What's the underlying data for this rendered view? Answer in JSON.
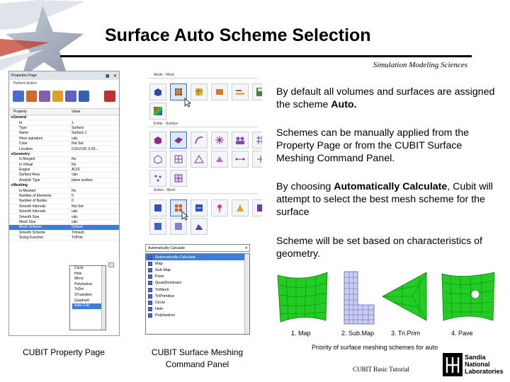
{
  "slide": {
    "title": "Surface Auto Scheme Selection",
    "subtitle": "Simulation Modeling Sciences",
    "footer": "CUBIT Basic Tutorial",
    "logo_lines": [
      "Sandia",
      "National",
      "Laboratories"
    ]
  },
  "property_page": {
    "header": "Properties Page",
    "perform_action_label": "Perform Action",
    "columns": [
      "Property",
      "Value"
    ],
    "rows": [
      {
        "group": true,
        "property": "General",
        "value": ""
      },
      {
        "property": "Id",
        "value": "1"
      },
      {
        "property": "Type",
        "value": "Surface"
      },
      {
        "property": "Name",
        "value": "Surface 1"
      },
      {
        "property": "Hess signature",
        "value": "calc"
      },
      {
        "property": "Color",
        "value": "Not Set"
      },
      {
        "property": "Location",
        "value": "0.00,0.00, 0.00..."
      },
      {
        "group": true,
        "property": "Geometry",
        "value": ""
      },
      {
        "property": "Is Merged",
        "value": "No"
      },
      {
        "property": "Is Virtual",
        "value": "No"
      },
      {
        "property": "Engine",
        "value": "ACIS"
      },
      {
        "property": "Surface Area",
        "value": "calc"
      },
      {
        "property": "Analytic Type",
        "value": "plane surface"
      },
      {
        "group": true,
        "property": "Meshing",
        "value": ""
      },
      {
        "property": "Is Meshed",
        "value": "No"
      },
      {
        "property": "Number of Elements",
        "value": "0"
      },
      {
        "property": "Number of Nodes",
        "value": "0"
      },
      {
        "property": "Smooth Intervals",
        "value": "Not Set"
      },
      {
        "property": "Smooth Intervals",
        "value": "calc"
      },
      {
        "property": "Smooth Size",
        "value": "calc"
      },
      {
        "property": "Mesh Size",
        "value": "calc"
      },
      {
        "property": "Mesh Scheme",
        "value": "Default",
        "selected": true
      },
      {
        "property": "Smooth Scheme",
        "value": "Trimesh"
      },
      {
        "property": "Sizing Function",
        "value": "TriPrim"
      }
    ],
    "dropdown_options": [
      "Circle",
      "Hole",
      "Mirror",
      "Polyhedron",
      "TriDel",
      "STransition",
      "Quadrant",
      "Auto Calc"
    ],
    "dropdown_selected": "Auto Calc",
    "dots_label": "..."
  },
  "command_panel": {
    "sections": [
      "Mode - Mesh",
      "Entity - Surface",
      "Action - Mesh"
    ],
    "select_value": "Automatically Calculate",
    "options": [
      {
        "label": "Automatically Calculate",
        "selected": true
      },
      {
        "label": "Map"
      },
      {
        "label": "Sub Map"
      },
      {
        "label": "Pave"
      },
      {
        "label": "QuadDominant"
      },
      {
        "label": "TriMesh"
      },
      {
        "label": "TriPrimitive"
      },
      {
        "label": "Circle"
      },
      {
        "label": "Hole"
      },
      {
        "label": "Polyhedron"
      }
    ]
  },
  "captions": {
    "property_page": "CUBIT Property Page",
    "command_panel_line1": "CUBIT Surface Meshing",
    "command_panel_line2": "Command Panel"
  },
  "bullets": [
    {
      "pre": "By default all volumes and surfaces are assigned the scheme ",
      "bold": "Auto.",
      "post": ""
    },
    {
      "pre": "Schemes can be manually applied from the Property Page or from the CUBIT Surface Meshing Command Panel.",
      "bold": "",
      "post": ""
    },
    {
      "pre": "By choosing ",
      "bold": "Automatically Calculate",
      "post": ", Cubit will attempt to select the best mesh scheme for the surface"
    },
    {
      "pre": "Scheme will be set based on characteristics of geometry.",
      "bold": "",
      "post": ""
    }
  ],
  "schemes": {
    "labels": [
      "1. Map",
      "2. Sub.Map",
      "3. Tri.Prim",
      "4. Pave"
    ],
    "caption": "Priority of surface meshing schemes for auto"
  },
  "colors": {
    "mesh_green": "#22cc22",
    "mesh_blue": "#c9cdf3",
    "selection_blue": "#3b7dd8"
  },
  "icons": [
    "star-decor-icon",
    "pin-icon",
    "close-icon",
    "mesh-cube-icon",
    "save-icon",
    "cursor-icon",
    "sandia-thunderbird-icon"
  ]
}
